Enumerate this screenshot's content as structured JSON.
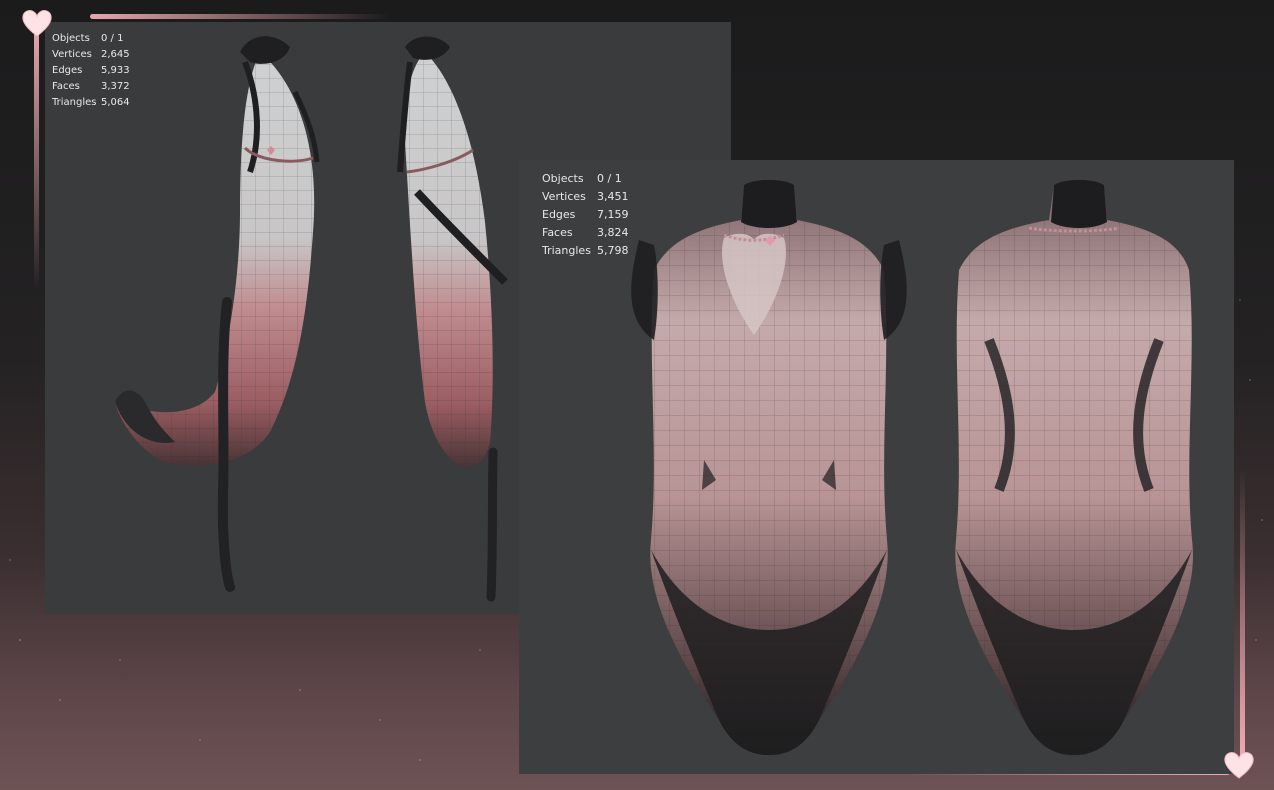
{
  "left_viewport": {
    "stats": [
      {
        "label": "Objects",
        "value": "0 / 1"
      },
      {
        "label": "Vertices",
        "value": "2,645"
      },
      {
        "label": "Edges",
        "value": "5,933"
      },
      {
        "label": "Faces",
        "value": "3,372"
      },
      {
        "label": "Triangles",
        "value": "5,064"
      }
    ]
  },
  "right_viewport": {
    "stats": [
      {
        "label": "Objects",
        "value": "0 / 1"
      },
      {
        "label": "Vertices",
        "value": "3,451"
      },
      {
        "label": "Edges",
        "value": "7,159"
      },
      {
        "label": "Faces",
        "value": "3,824"
      },
      {
        "label": "Triangles",
        "value": "5,798"
      }
    ]
  },
  "colors": {
    "accent_pink": "#ffb4be",
    "viewport_bg": "#3c3d3f",
    "mesh_light": "#d9d6d6",
    "mesh_pink": "#b77d80",
    "mesh_dark": "#1e1e20"
  }
}
